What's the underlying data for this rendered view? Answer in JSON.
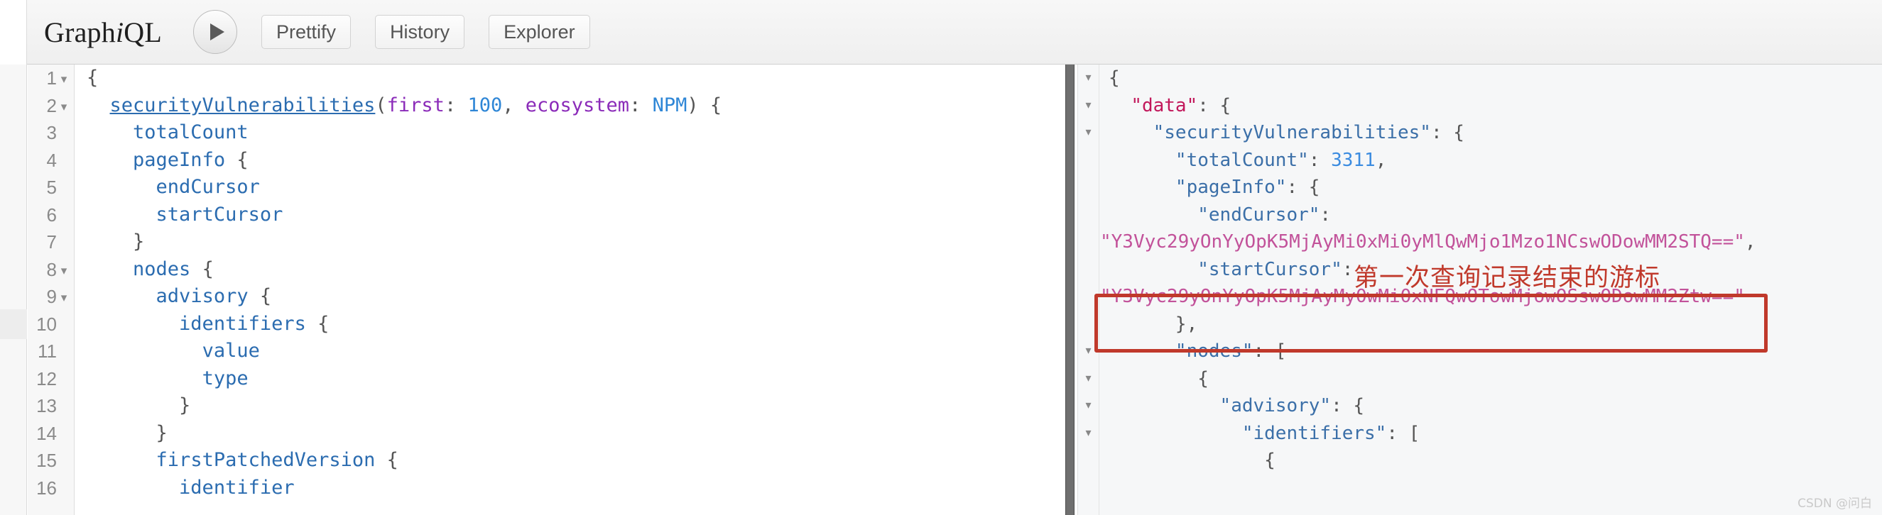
{
  "app": {
    "brand_plain_1": "Graph",
    "brand_italic": "i",
    "brand_plain_2": "QL",
    "watermark": "CSDN @问白"
  },
  "toolbar": {
    "execute_label": "▶",
    "execute_name": "play-icon",
    "buttons": [
      {
        "label": "Prettify"
      },
      {
        "label": "History"
      },
      {
        "label": "Explorer"
      }
    ]
  },
  "editor": {
    "lines": [
      {
        "num": "1",
        "fold": "▾",
        "tokens": [
          {
            "t": "{",
            "c": "tok-punct"
          }
        ]
      },
      {
        "num": "2",
        "fold": "▾",
        "tokens": [
          {
            "t": "  ",
            "c": "tok-punct"
          },
          {
            "t": "securityVulnerabilities",
            "c": "tok-fieldu"
          },
          {
            "t": "(",
            "c": "tok-punct"
          },
          {
            "t": "first",
            "c": "tok-arg"
          },
          {
            "t": ": ",
            "c": "tok-punct"
          },
          {
            "t": "100",
            "c": "tok-num"
          },
          {
            "t": ", ",
            "c": "tok-punct"
          },
          {
            "t": "ecosystem",
            "c": "tok-arg"
          },
          {
            "t": ": ",
            "c": "tok-punct"
          },
          {
            "t": "NPM",
            "c": "tok-enum"
          },
          {
            "t": ") {",
            "c": "tok-punct"
          }
        ]
      },
      {
        "num": "3",
        "fold": "",
        "tokens": [
          {
            "t": "    ",
            "c": "tok-punct"
          },
          {
            "t": "totalCount",
            "c": "tok-field"
          }
        ]
      },
      {
        "num": "4",
        "fold": "",
        "tokens": [
          {
            "t": "    ",
            "c": "tok-punct"
          },
          {
            "t": "pageInfo",
            "c": "tok-field"
          },
          {
            "t": " {",
            "c": "tok-punct"
          }
        ]
      },
      {
        "num": "5",
        "fold": "",
        "tokens": [
          {
            "t": "      ",
            "c": "tok-punct"
          },
          {
            "t": "endCursor",
            "c": "tok-field"
          }
        ]
      },
      {
        "num": "6",
        "fold": "",
        "tokens": [
          {
            "t": "      ",
            "c": "tok-punct"
          },
          {
            "t": "startCursor",
            "c": "tok-field"
          }
        ]
      },
      {
        "num": "7",
        "fold": "",
        "tokens": [
          {
            "t": "    }",
            "c": "tok-punct"
          }
        ]
      },
      {
        "num": "8",
        "fold": "▾",
        "tokens": [
          {
            "t": "    ",
            "c": "tok-punct"
          },
          {
            "t": "nodes",
            "c": "tok-field"
          },
          {
            "t": " {",
            "c": "tok-punct"
          }
        ]
      },
      {
        "num": "9",
        "fold": "▾",
        "tokens": [
          {
            "t": "      ",
            "c": "tok-punct"
          },
          {
            "t": "advisory",
            "c": "tok-field"
          },
          {
            "t": " {",
            "c": "tok-punct"
          }
        ]
      },
      {
        "num": "10",
        "fold": "",
        "tokens": [
          {
            "t": "        ",
            "c": "tok-punct"
          },
          {
            "t": "identifiers",
            "c": "tok-field"
          },
          {
            "t": " {",
            "c": "tok-punct"
          }
        ]
      },
      {
        "num": "11",
        "fold": "",
        "tokens": [
          {
            "t": "          ",
            "c": "tok-punct"
          },
          {
            "t": "value",
            "c": "tok-field"
          }
        ]
      },
      {
        "num": "12",
        "fold": "",
        "tokens": [
          {
            "t": "          ",
            "c": "tok-punct"
          },
          {
            "t": "type",
            "c": "tok-field"
          }
        ]
      },
      {
        "num": "13",
        "fold": "",
        "tokens": [
          {
            "t": "        }",
            "c": "tok-punct"
          }
        ]
      },
      {
        "num": "14",
        "fold": "",
        "tokens": [
          {
            "t": "      }",
            "c": "tok-punct"
          }
        ]
      },
      {
        "num": "15",
        "fold": "",
        "tokens": [
          {
            "t": "      ",
            "c": "tok-punct"
          },
          {
            "t": "firstPatchedVersion",
            "c": "tok-field"
          },
          {
            "t": " {",
            "c": "tok-punct"
          }
        ]
      },
      {
        "num": "16",
        "fold": "",
        "tokens": [
          {
            "t": "        ",
            "c": "tok-punct"
          },
          {
            "t": "identifier",
            "c": "tok-field"
          }
        ]
      }
    ]
  },
  "result": {
    "lines": [
      {
        "fold": "▾",
        "tokens": [
          {
            "t": "{",
            "c": "jpunct"
          }
        ]
      },
      {
        "fold": "▾",
        "tokens": [
          {
            "t": "  ",
            "c": "jpunct"
          },
          {
            "t": "\"data\"",
            "c": "jkey-d"
          },
          {
            "t": ": {",
            "c": "jpunct"
          }
        ]
      },
      {
        "fold": "▾",
        "tokens": [
          {
            "t": "    ",
            "c": "jpunct"
          },
          {
            "t": "\"securityVulnerabilities\"",
            "c": "jkey"
          },
          {
            "t": ": {",
            "c": "jpunct"
          }
        ]
      },
      {
        "fold": "",
        "tokens": [
          {
            "t": "      ",
            "c": "jpunct"
          },
          {
            "t": "\"totalCount\"",
            "c": "jkey"
          },
          {
            "t": ": ",
            "c": "jpunct"
          },
          {
            "t": "3311",
            "c": "jnum"
          },
          {
            "t": ",",
            "c": "jpunct"
          }
        ]
      },
      {
        "fold": "",
        "tokens": [
          {
            "t": "      ",
            "c": "jpunct"
          },
          {
            "t": "\"pageInfo\"",
            "c": "jkey"
          },
          {
            "t": ": {",
            "c": "jpunct"
          }
        ]
      },
      {
        "fold": "",
        "tokens": [
          {
            "t": "        ",
            "c": "jpunct"
          },
          {
            "t": "\"endCursor\"",
            "c": "jkey"
          },
          {
            "t": ":",
            "c": "jpunct"
          }
        ]
      },
      {
        "fold": "",
        "tokens": [
          {
            "t": "\"Y3Vyc29yOnYyOpK5MjAyMi0xMi0yMlQwMjo1Mzo1NCswODowMM2STQ==\"",
            "c": "jstr"
          },
          {
            "t": ",",
            "c": "jpunct"
          }
        ],
        "nopad": true
      },
      {
        "fold": "",
        "tokens": [
          {
            "t": "        ",
            "c": "jpunct"
          },
          {
            "t": "\"startCursor\"",
            "c": "jkey"
          },
          {
            "t": ":",
            "c": "jpunct"
          }
        ]
      },
      {
        "fold": "",
        "tokens": [
          {
            "t": "\"Y3Vyc29yOnYyOpK5MjAyMy0wMi0xNFQwOTowMjowOSswODowMM2Ztw==\"",
            "c": "jstr"
          }
        ],
        "nopad": true
      },
      {
        "fold": "",
        "tokens": [
          {
            "t": "      },",
            "c": "jpunct"
          }
        ]
      },
      {
        "fold": "▾",
        "tokens": [
          {
            "t": "      ",
            "c": "jpunct"
          },
          {
            "t": "\"nodes\"",
            "c": "jkey"
          },
          {
            "t": ": [",
            "c": "jpunct"
          }
        ]
      },
      {
        "fold": "▾",
        "tokens": [
          {
            "t": "        {",
            "c": "jpunct"
          }
        ]
      },
      {
        "fold": "▾",
        "tokens": [
          {
            "t": "          ",
            "c": "jpunct"
          },
          {
            "t": "\"advisory\"",
            "c": "jkey"
          },
          {
            "t": ": {",
            "c": "jpunct"
          }
        ]
      },
      {
        "fold": "▾",
        "tokens": [
          {
            "t": "            ",
            "c": "jpunct"
          },
          {
            "t": "\"identifiers\"",
            "c": "jkey"
          },
          {
            "t": ": [",
            "c": "jpunct"
          }
        ]
      },
      {
        "fold": "",
        "tokens": [
          {
            "t": "              {",
            "c": "jpunct"
          }
        ]
      }
    ]
  },
  "annotation": {
    "text": "第一次查询记录结束的游标",
    "color": "#c0392b"
  }
}
